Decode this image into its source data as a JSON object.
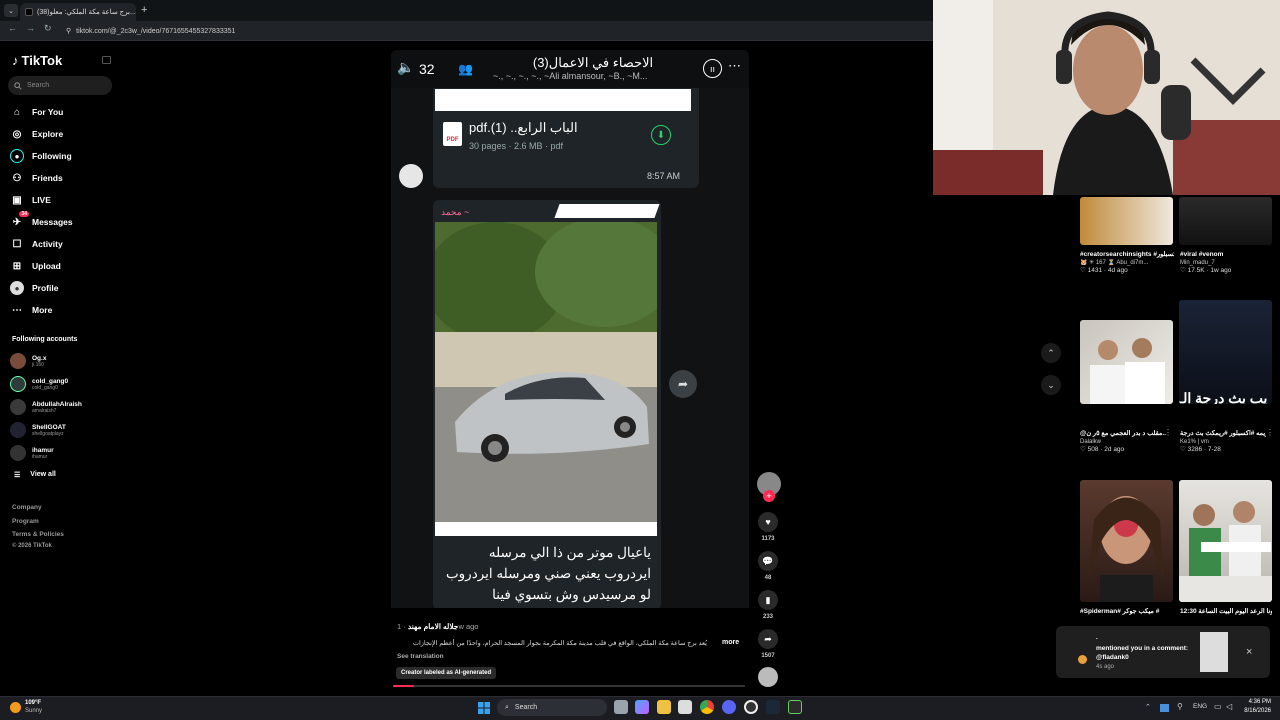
{
  "browser": {
    "tab_title": "(38)برج ساعة مكة الملكي: معلو...",
    "tab_close": "×",
    "new_tab": "+",
    "url": "tiktok.com/@_2c3w_/video/7671655455327833351"
  },
  "sidebar": {
    "logo": "TikTok",
    "search_placeholder": "Search",
    "nav": [
      {
        "label": "For You",
        "icon": "home-icon"
      },
      {
        "label": "Explore",
        "icon": "compass-icon"
      },
      {
        "label": "Following",
        "icon": "following-icon"
      },
      {
        "label": "Friends",
        "icon": "friends-icon"
      },
      {
        "label": "LIVE",
        "icon": "live-icon"
      },
      {
        "label": "Messages",
        "icon": "messages-icon",
        "badge": "34"
      },
      {
        "label": "Activity",
        "icon": "activity-icon"
      },
      {
        "label": "Upload",
        "icon": "upload-icon"
      },
      {
        "label": "Profile",
        "icon": "profile-icon"
      },
      {
        "label": "More",
        "icon": "more-icon"
      }
    ],
    "following_title": "Following accounts",
    "accounts": [
      {
        "name": "Og.x",
        "handle": "ji.160"
      },
      {
        "name": "cold_gang0",
        "handle": "cold_gang0"
      },
      {
        "name": "AbdullahAlraish",
        "handle": "amalraish7"
      },
      {
        "name": "ShellGOAT",
        "handle": "shellgoatplayz"
      },
      {
        "name": "ihamur",
        "handle": "ihamur"
      }
    ],
    "view_all": "View all",
    "footer": [
      "Company",
      "Program",
      "Terms & Policies",
      "© 2026 TikTok"
    ]
  },
  "video": {
    "chat_header": {
      "back_count": "32",
      "group_name": "الاحصاء في الاعمال(3)",
      "members": "~., ~., ~., ~., ~Ali almansour, ~B., ~M..."
    },
    "doc": {
      "name": "الباب الرابع.. (1).pdf",
      "meta": "30 pages · 2.6 MB · pdf",
      "time": "8:57 AM",
      "icon_label": "PDF"
    },
    "image_msg": {
      "sender": "~ محمد",
      "caption": "ياعيال موتر من ذا الي مرسله ايردروب يعني صني ومرسله ايردروب لو مرسيدس وش بتسوي فينا"
    }
  },
  "rail": {
    "likes": "1173",
    "comments": "48",
    "saves": "233",
    "shares": "1507"
  },
  "caption": {
    "author": "جلاله الامام مهند",
    "age": "· 1w ago",
    "text": "يُعد برج ساعة مكة الملكي، الواقع في قلب مدينة مكة المكرمة بجوار المسجد الحرام، واحدًا من أعظم الإنجازات",
    "more": "more",
    "see_translation": "See translation",
    "ai_label": "Creator labeled as AI-generated",
    "progress": 0.06
  },
  "feed": [
    {
      "title": "#creatorsearchinsights #اكسبلور explore...",
      "sub": "🐹 ✳ 167 ⏳ Abu_di7m...",
      "likes": "1431",
      "age": "4d ago"
    },
    {
      "title": "#viral #venom",
      "sub": "Min_madu_7",
      "likes": "17.5K",
      "age": "1w ago"
    },
    {
      "title": "@مقلب د بدر العجمي مع ٥ر ن... @",
      "sub": "Dalalkw",
      "likes": "508",
      "age": "2d ago"
    },
    {
      "title": "عقاب #فريمه #اكسبلور #ريمكث بث درجة...",
      "sub": "Ke1% | vm",
      "likes": "3286",
      "age": "7-28"
    },
    {
      "title": "#Spiderman# ميكب جوكر #",
      "sub": "",
      "likes": "",
      "age": ""
    },
    {
      "title": "تركيونا الرعد اليوم البيت الساعة 12:30 ...",
      "sub": "",
      "likes": "",
      "age": ""
    }
  ],
  "notification": {
    "line1": ".",
    "line2": "mentioned you in a comment: @fladank0",
    "age": "4s ago",
    "close": "×"
  },
  "taskbar": {
    "weather_temp": "109°F",
    "weather_text": "Sunny",
    "search": "Search",
    "lang": "ENG",
    "time": "4:36 PM",
    "date": "8/16/2026"
  },
  "colors": {
    "accent": "#fe2c55",
    "wa_green": "#25d366",
    "bg": "#000000"
  }
}
